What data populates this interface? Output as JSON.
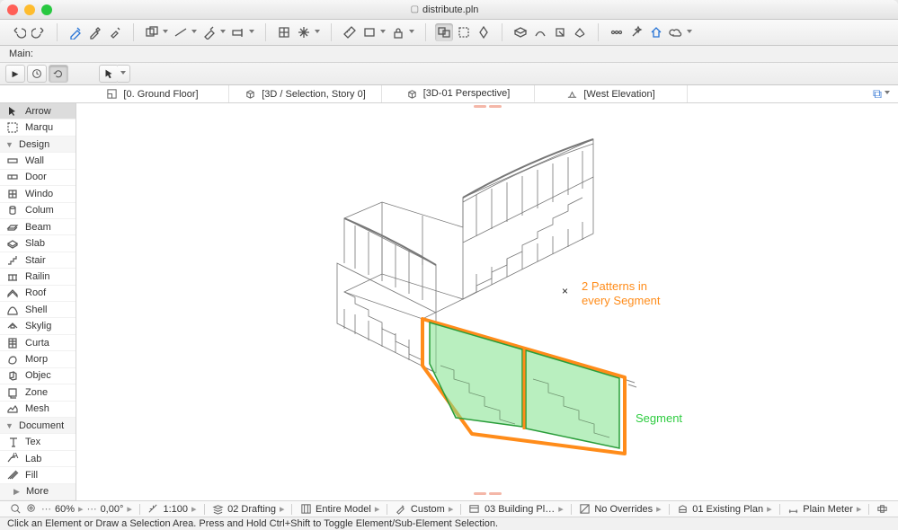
{
  "window": {
    "title": "distribute.pln"
  },
  "subbar": {
    "label": "Main:"
  },
  "tabs": [
    {
      "label": "[0. Ground Floor]"
    },
    {
      "label": "[3D / Selection, Story 0]"
    },
    {
      "label": "[3D-01 Perspective]"
    },
    {
      "label": "[West Elevation]"
    }
  ],
  "toolbox": {
    "sel_header": {
      "arrow": "Arrow",
      "marquee": "Marqu"
    },
    "design_label": "Design",
    "design": [
      {
        "name": "Wall"
      },
      {
        "name": "Door"
      },
      {
        "name": "Windo"
      },
      {
        "name": "Colum"
      },
      {
        "name": "Beam"
      },
      {
        "name": "Slab"
      },
      {
        "name": "Stair"
      },
      {
        "name": "Railin"
      },
      {
        "name": "Roof"
      },
      {
        "name": "Shell"
      },
      {
        "name": "Skylig"
      },
      {
        "name": "Curta"
      },
      {
        "name": "Morp"
      },
      {
        "name": "Objec"
      },
      {
        "name": "Zone"
      },
      {
        "name": "Mesh"
      }
    ],
    "doc_label": "Document",
    "doc": [
      {
        "name": "Tex"
      },
      {
        "name": "Lab"
      },
      {
        "name": "Fill"
      }
    ],
    "more": "More"
  },
  "annotations": {
    "patterns": "2 Patterns in\nevery Segment",
    "segment": "Segment",
    "xmark": "×"
  },
  "status": {
    "zoom": "60%",
    "angle": "0,00°",
    "scale": "1:100",
    "layercombo": "02 Drafting",
    "model": "Entire Model",
    "pen": "Custom",
    "render": "03 Building Pl…",
    "override": "No Overrides",
    "reno": "01 Existing Plan",
    "dim": "Plain Meter"
  },
  "hint": "Click an Element or Draw a Selection Area. Press and Hold Ctrl+Shift to Toggle Element/Sub-Element Selection.",
  "icons": {
    "undo": "undo",
    "redo": "redo"
  }
}
